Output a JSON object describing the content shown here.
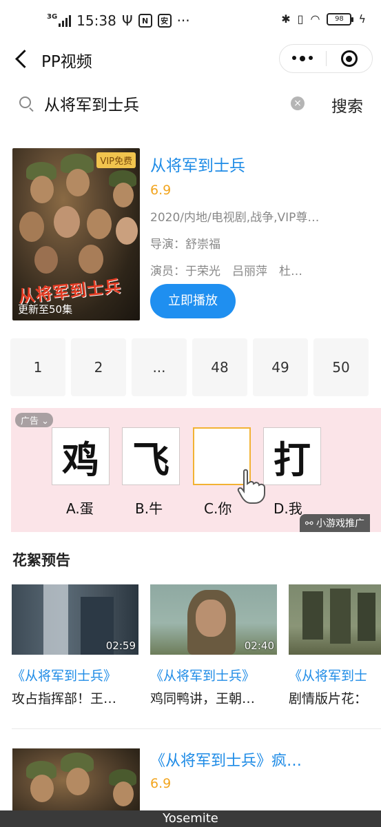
{
  "status_bar": {
    "network": "3G",
    "time": "15:38",
    "icon_a": "N",
    "icon_b": "安",
    "more": "···",
    "battery": "98"
  },
  "nav": {
    "title": "PP视频"
  },
  "search": {
    "value": "从将军到士兵",
    "button": "搜索"
  },
  "movie": {
    "vip_badge": "VIP免费",
    "poster_title": "从将军到士兵",
    "poster_update": "更新至50集",
    "title": "从将军到士兵",
    "rating": "6.9",
    "meta": "2020/内地/电视剧,战争,VIP尊…",
    "director": "导演：舒崇福",
    "cast": "演员：于荣光　吕丽萍　杜…",
    "play_button": "立即播放"
  },
  "episodes": [
    "1",
    "2",
    "...",
    "48",
    "49",
    "50"
  ],
  "ad": {
    "tag": "广告",
    "tiles": [
      "鸡",
      "飞",
      "",
      "打"
    ],
    "options": [
      "A.蛋",
      "B.牛",
      "C.你",
      "D.我"
    ],
    "source": "小游戏推广"
  },
  "clips_section": {
    "title": "花絮预告",
    "items": [
      {
        "duration": "02:59",
        "title": "《从将军到士兵》",
        "desc": "攻占指挥部！王…"
      },
      {
        "duration": "02:40",
        "title": "《从将军到士兵》",
        "desc": "鸡同鸭讲，王朝…"
      },
      {
        "duration": "",
        "title": "《从将军到士",
        "desc": "剧情版片花："
      }
    ]
  },
  "movie2": {
    "title": "《从将军到士兵》疯…",
    "rating": "6.9"
  },
  "bottom_bar": {
    "label": "Yosemite"
  }
}
